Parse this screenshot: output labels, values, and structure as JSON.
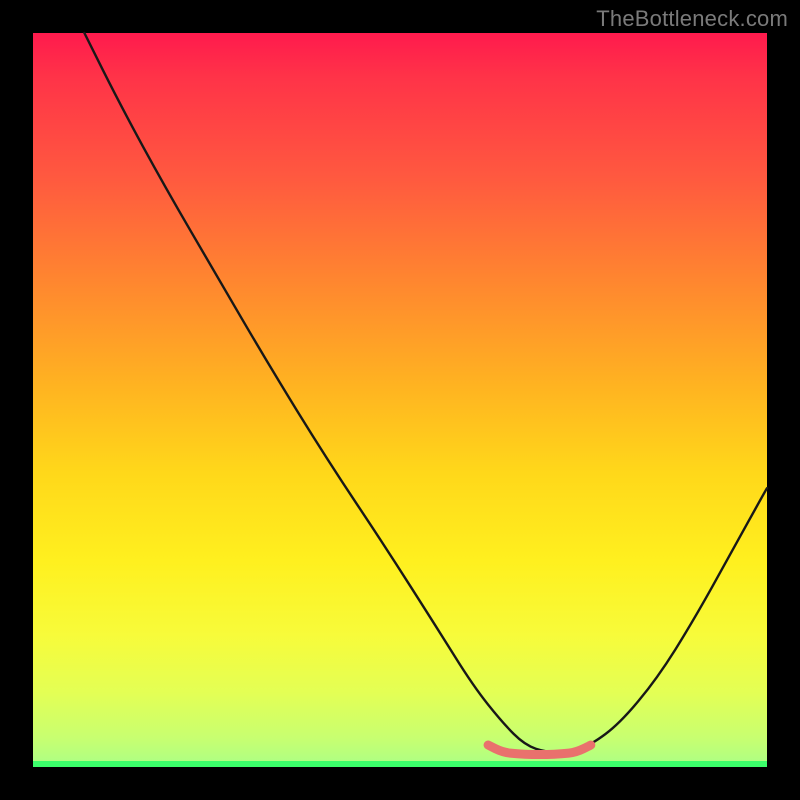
{
  "watermark": "TheBottleneck.com",
  "chart_data": {
    "type": "line",
    "title": "",
    "xlabel": "",
    "ylabel": "",
    "xlim": [
      0,
      100
    ],
    "ylim": [
      0,
      100
    ],
    "grid": false,
    "legend": false,
    "series": [
      {
        "name": "bottleneck-curve",
        "color": "#181818",
        "x": [
          7,
          12,
          18,
          25,
          32,
          40,
          48,
          55,
          60,
          64,
          67,
          70,
          73,
          76,
          80,
          85,
          90,
          95,
          100
        ],
        "y": [
          100,
          90,
          79,
          67,
          55,
          42,
          30,
          19,
          11,
          6,
          3,
          2,
          2,
          3,
          6,
          12,
          20,
          29,
          38
        ]
      },
      {
        "name": "optimal-zone",
        "color": "#e9716d",
        "x": [
          62,
          64,
          66,
          68,
          70,
          72,
          74,
          76
        ],
        "y": [
          3,
          2,
          1.8,
          1.7,
          1.7,
          1.8,
          2,
          3
        ]
      }
    ],
    "background_gradient": {
      "top": "#ff1a4d",
      "upper_mid": "#ff8a2e",
      "mid": "#ffd81a",
      "lower_mid": "#e3ff55",
      "bottom": "#aaff86"
    },
    "baseline_color": "#3cff6b"
  }
}
